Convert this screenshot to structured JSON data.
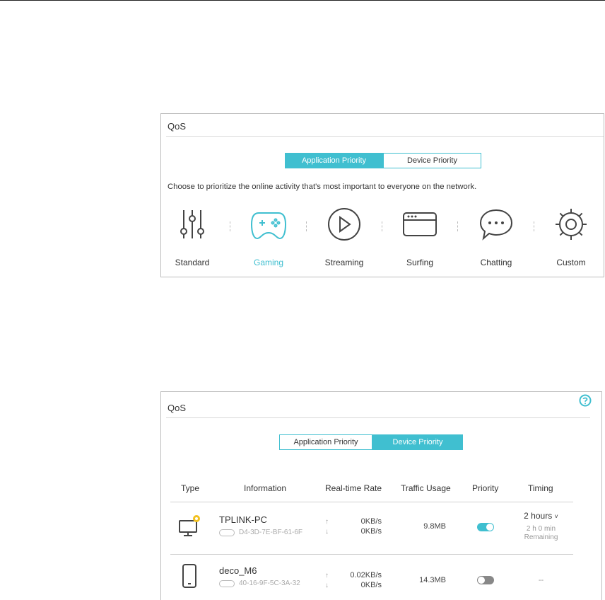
{
  "qos_app": {
    "title": "QoS",
    "tabs": [
      "Application Priority",
      "Device Priority"
    ],
    "active_tab": "Application Priority",
    "description": "Choose to prioritize the online activity that's most important to everyone on the network.",
    "modes": [
      {
        "label": "Standard",
        "icon": "sliders-icon",
        "active": false
      },
      {
        "label": "Gaming",
        "icon": "gamepad-icon",
        "active": true
      },
      {
        "label": "Streaming",
        "icon": "play-icon",
        "active": false
      },
      {
        "label": "Surfing",
        "icon": "browser-window-icon",
        "active": false
      },
      {
        "label": "Chatting",
        "icon": "chat-bubble-icon",
        "active": false
      },
      {
        "label": "Custom",
        "icon": "gear-icon",
        "active": false
      }
    ],
    "accent": "#40bfd0"
  },
  "qos_device": {
    "title": "QoS",
    "tabs": [
      "Application Priority",
      "Device Priority"
    ],
    "active_tab": "Device Priority",
    "columns": [
      "Type",
      "Information",
      "Real-time Rate",
      "Traffic Usage",
      "Priority",
      "Timing"
    ],
    "rows": [
      {
        "type_icon": "desktop-icon",
        "name": "TPLINK-PC",
        "mac": "D4-3D-7E-BF-61-6F",
        "upload": "0KB/s",
        "download": "0KB/s",
        "usage": "9.8MB",
        "priority_on": true,
        "timing": "2 hours",
        "remaining": [
          "2 h 0 min",
          "Remaining"
        ]
      },
      {
        "type_icon": "phone-icon",
        "name": "deco_M6",
        "mac": "40-16-9F-5C-3A-32",
        "upload": "0.02KB/s",
        "download": "0KB/s",
        "usage": "14.3MB",
        "priority_on": false,
        "timing": "--",
        "remaining": []
      }
    ]
  }
}
